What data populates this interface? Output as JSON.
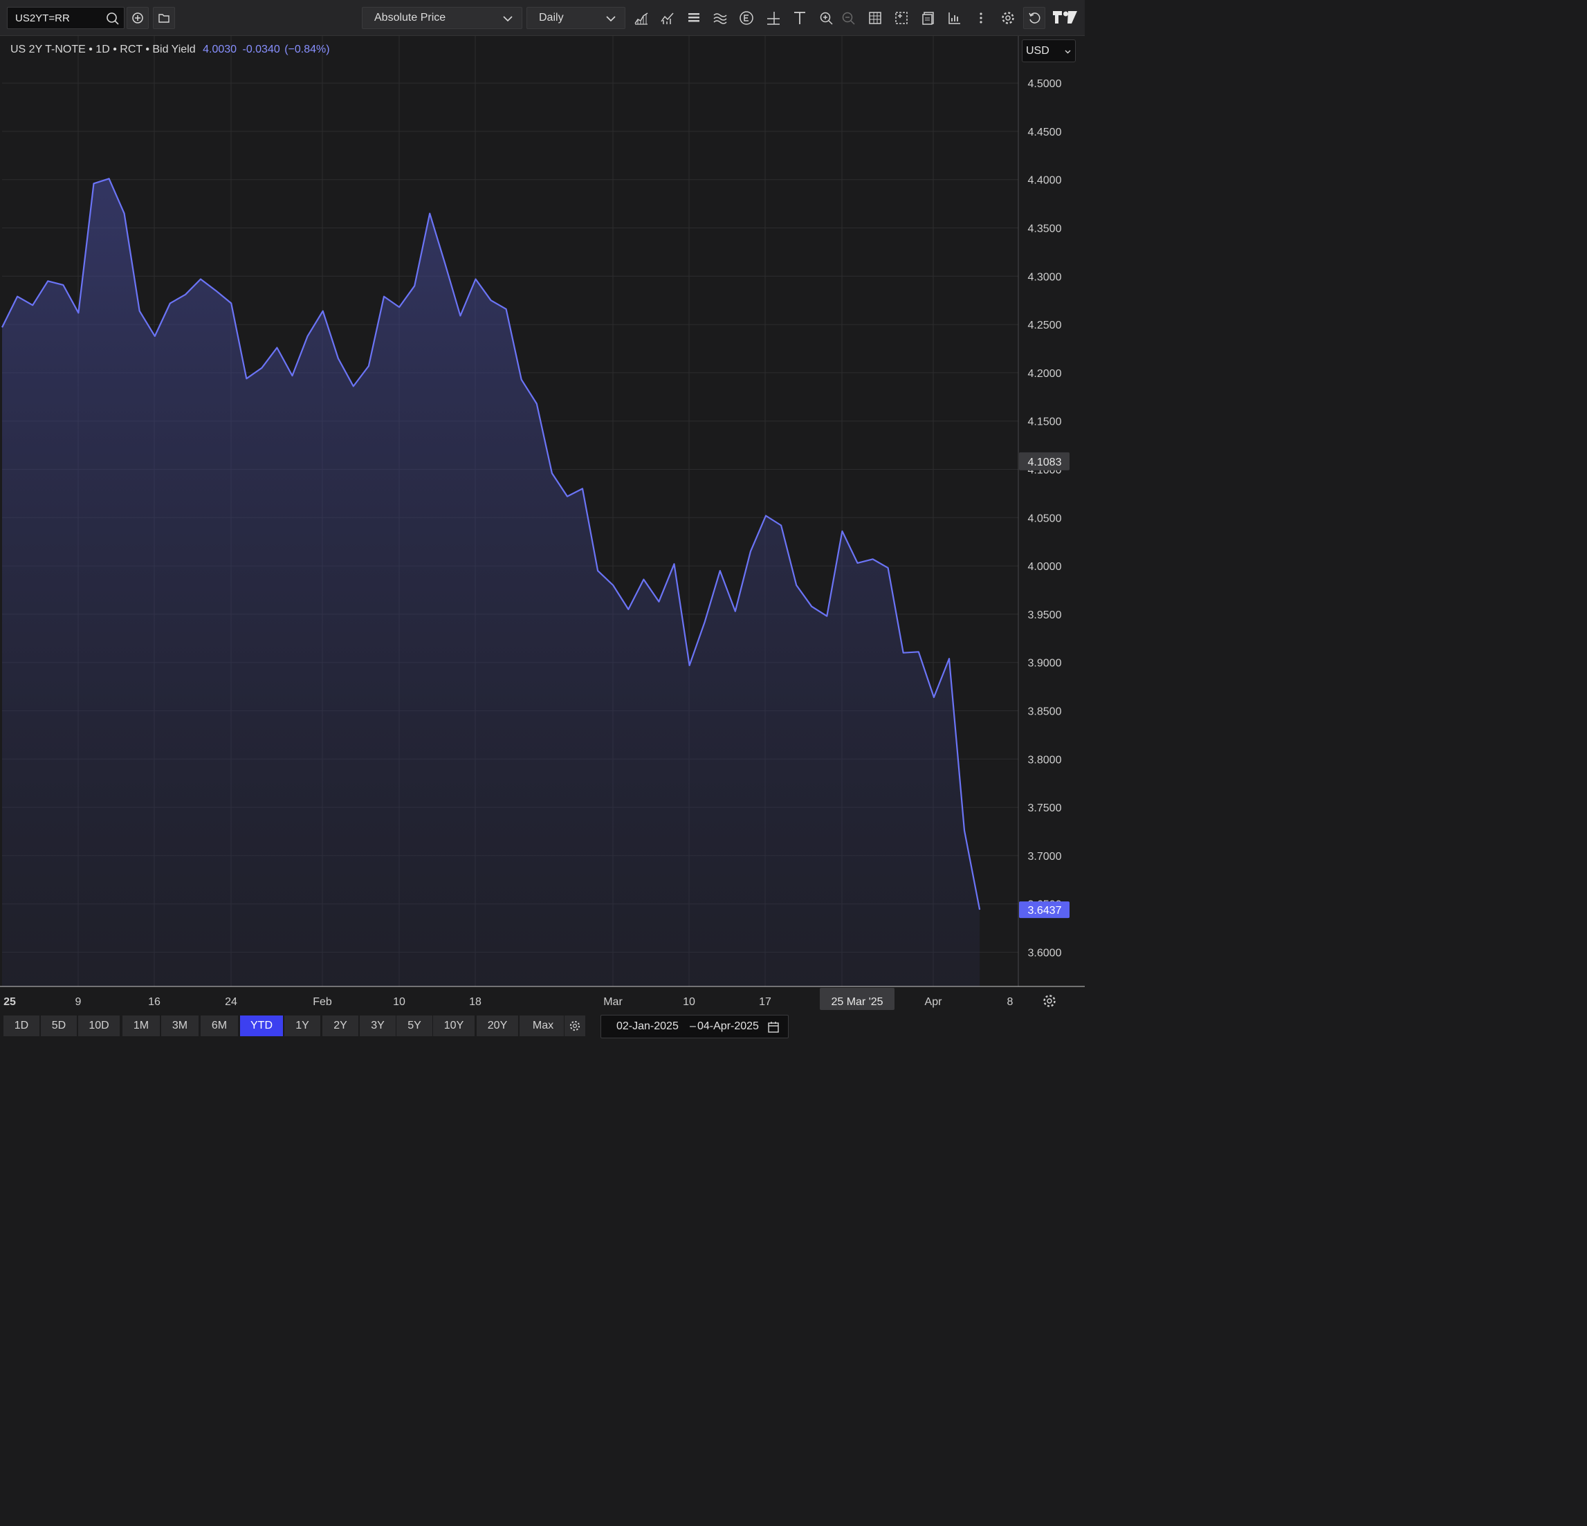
{
  "toolbar": {
    "symbol": "US2YT=RR",
    "price_type": "Absolute Price",
    "interval": "Daily",
    "icons": [
      "chart-type-icon",
      "indicators-icon",
      "lines-icon",
      "studies-icon",
      "events-icon",
      "crosshair-icon",
      "text-icon",
      "zoom-in-icon",
      "zoom-out-icon",
      "data-table-icon",
      "layout-icon",
      "export-icon",
      "compare-icon",
      "more-icon",
      "settings-icon",
      "reset-icon"
    ]
  },
  "legend": {
    "name": "US 2Y T-NOTE",
    "interval": "1D",
    "source": "RCT",
    "field": "Bid Yield",
    "last": "4.0030",
    "change": "-0.0340",
    "change_pct": "(−0.84%)",
    "separator": "•"
  },
  "currency": "USD",
  "price_labels": {
    "crosshair": "4.1083",
    "last": "3.6437"
  },
  "x_tooltip": "25 Mar '25",
  "ranges": [
    "1D",
    "5D",
    "10D",
    "1M",
    "3M",
    "6M",
    "YTD",
    "1Y",
    "2Y",
    "3Y",
    "5Y",
    "10Y",
    "20Y",
    "Max"
  ],
  "active_range": "YTD",
  "date_range": {
    "from": "02-Jan-2025",
    "sep": "–",
    "to": "04-Apr-2025"
  },
  "colors": {
    "line": "#6b74f6",
    "active": "#3c40f0",
    "background": "#1b1b1c"
  },
  "chart_data": {
    "type": "area",
    "y_ticks": [
      "3.6000",
      "3.6500",
      "3.7000",
      "3.7500",
      "3.8000",
      "3.8500",
      "3.9000",
      "3.9500",
      "4.0000",
      "4.0500",
      "4.1000",
      "4.1500",
      "4.2000",
      "4.2500",
      "4.3000",
      "4.3500",
      "4.4000",
      "4.4500",
      "4.5000"
    ],
    "ylim": [
      3.6,
      4.5
    ],
    "x_ticks": [
      "25",
      "9",
      "16",
      "24",
      "Feb",
      "10",
      "18",
      "Mar",
      "10",
      "17",
      "Apr",
      "8"
    ],
    "grid": true,
    "series": [
      {
        "values": [
          4.247,
          4.279,
          4.27,
          4.295,
          4.291,
          4.262,
          4.396,
          4.401,
          4.365,
          4.264,
          4.238,
          4.272,
          4.281,
          4.297,
          4.285,
          4.272,
          4.194,
          4.205,
          4.226,
          4.197,
          4.238,
          4.264,
          4.215,
          4.186,
          4.207,
          4.279,
          4.268,
          4.29,
          4.365,
          4.313,
          4.259,
          4.297,
          4.275,
          4.266,
          4.193,
          4.168,
          4.096,
          4.072,
          4.08,
          3.995,
          3.98,
          3.955,
          3.986,
          3.963,
          4.002,
          3.897,
          3.942,
          3.995,
          3.953,
          4.015,
          4.052,
          4.042,
          3.98,
          3.958,
          3.948,
          4.036,
          4.003,
          4.007,
          3.998,
          3.91,
          3.911,
          3.864,
          3.904,
          3.726,
          3.644
        ]
      }
    ]
  }
}
